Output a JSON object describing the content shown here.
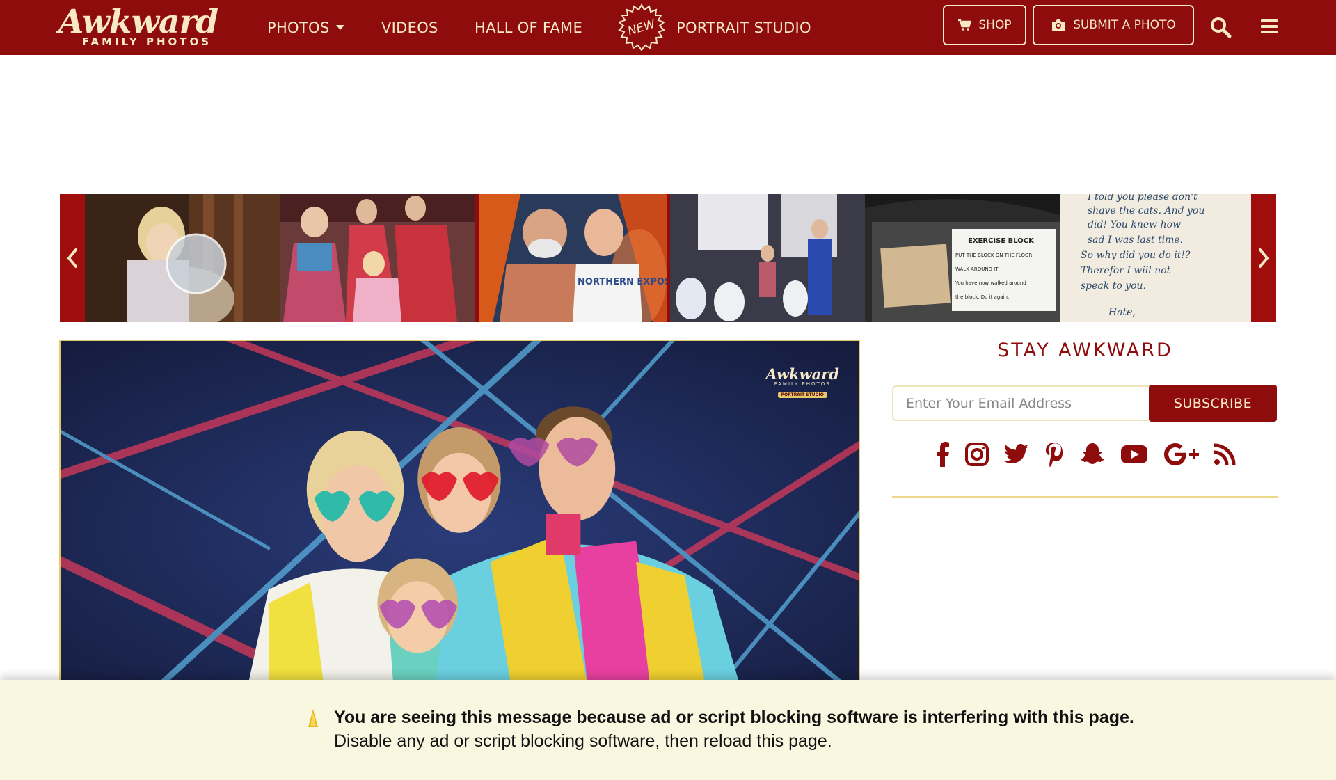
{
  "header": {
    "logo_main": "Awkward",
    "logo_sub": "FAMILY PHOTOS",
    "nav": {
      "photos": "PHOTOS",
      "videos": "VIDEOS",
      "hall_of_fame": "HALL OF FAME",
      "new_badge": "NEW",
      "portrait_studio": "PORTRAIT STUDIO"
    },
    "shop_label": "SHOP",
    "submit_label": "SUBMIT A PHOTO"
  },
  "carousel": {
    "note_lines": [
      "I told you please don't",
      "shave the cats. And you",
      "did! You knew how",
      "sad I was last time.",
      "So why did you do it!?",
      "Therefor I will not",
      "speak to you.",
      "Hate,"
    ],
    "exercise_block": {
      "title": "EXERCISE BLOCK",
      "line1": "PUT THE BLOCK ON THE FLOOR",
      "line2": "WALK AROUND IT",
      "line3": "You have now walked around",
      "line4": "the block. Do it again."
    },
    "shirt_text": "NORTHERN EXPOSURE"
  },
  "main_photo": {
    "watermark_main": "Awkward",
    "watermark_sub": "FAMILY PHOTOS",
    "watermark_tag": "PORTRAIT STUDIO"
  },
  "sidebar": {
    "heading": "STAY AWKWARD",
    "email_placeholder": "Enter Your Email Address",
    "subscribe_label": "SUBSCRIBE",
    "social": [
      "facebook",
      "instagram",
      "twitter",
      "pinterest",
      "snapchat",
      "youtube",
      "google-plus",
      "rss"
    ]
  },
  "banner": {
    "line1": "You are seeing this message because ad or script blocking software is interfering with this page.",
    "line2": "Disable any ad or script blocking software, then reload this page."
  },
  "colors": {
    "brand_red": "#8e0c0b",
    "cream": "#f7e9c7",
    "gold": "#e6c96b",
    "banner_bg": "#faf7e1"
  }
}
